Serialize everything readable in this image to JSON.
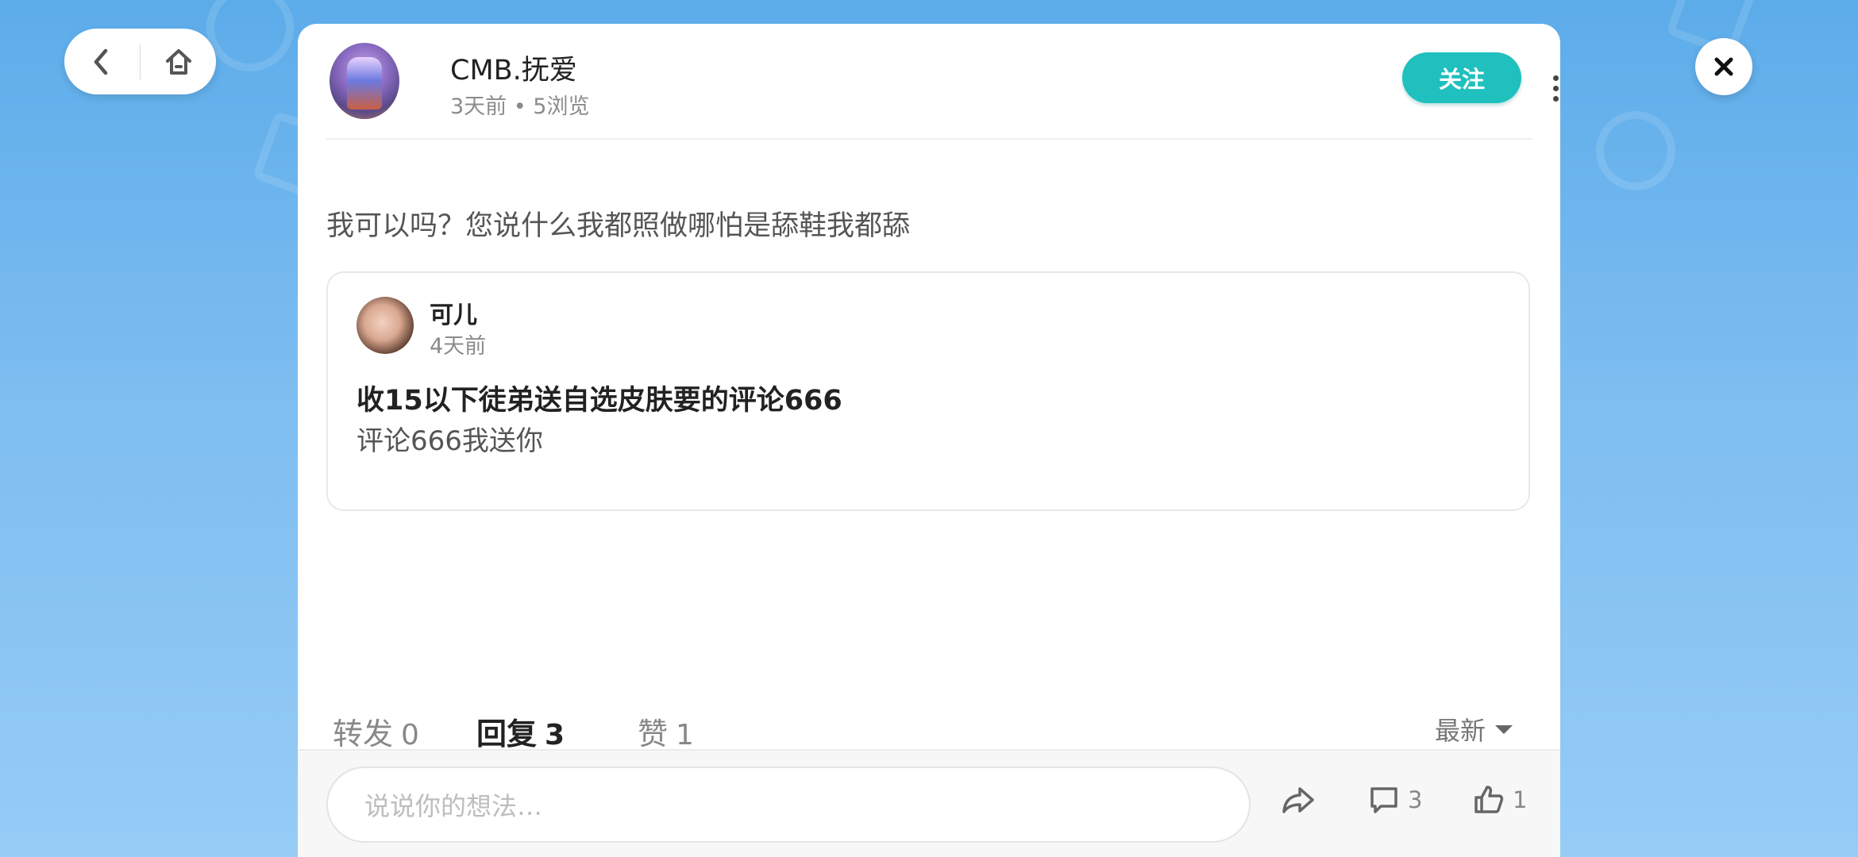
{
  "post": {
    "author": "CMB.抚爱",
    "meta": "3天前 • 5浏览",
    "follow_label": "关注",
    "text": "我可以吗？您说什么我都照做哪怕是舔鞋我都舔"
  },
  "quoted": {
    "author": "可儿",
    "time": "4天前",
    "title": "收15以下徒弟送自选皮肤要的评论666",
    "body": "评论666我送你"
  },
  "tabs": [
    {
      "label": "转发",
      "count": "0"
    },
    {
      "label": "回复",
      "count": "3",
      "active": true
    },
    {
      "label": "赞",
      "count": "1"
    }
  ],
  "sort_label": "最新",
  "comment_box": {
    "placeholder": "说说你的想法…"
  },
  "actions": {
    "comment_count": "3",
    "like_count": "1"
  },
  "colors": {
    "accent": "#1fc0bd",
    "background": "#6cb5ee"
  },
  "icons": [
    "back-icon",
    "home-icon",
    "close-icon",
    "more-vertical-icon",
    "share-icon",
    "comment-icon",
    "like-icon",
    "sort-caret-icon"
  ]
}
